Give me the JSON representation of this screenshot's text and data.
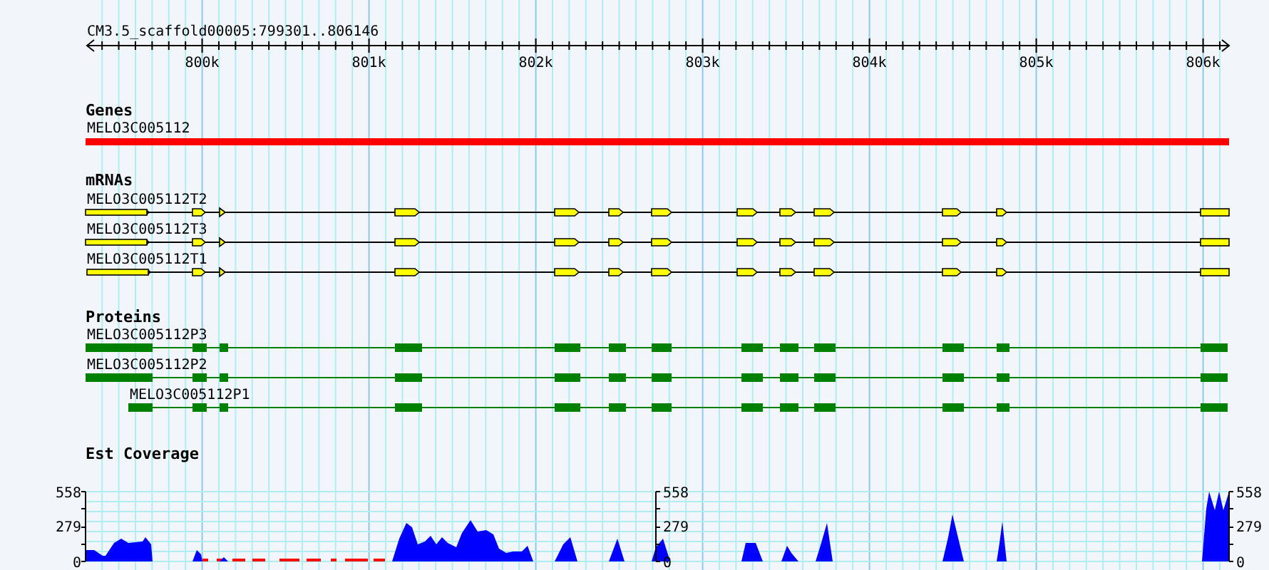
{
  "ruler": {
    "title": "CM3.5_scaffold00005:799301..806146",
    "ticks": [
      "800k",
      "801k",
      "802k",
      "803k",
      "804k",
      "805k",
      "806k"
    ]
  },
  "tracks": [
    {
      "kind": "gene",
      "title": "Genes",
      "features": [
        {
          "name": "MELO3C005112"
        }
      ]
    },
    {
      "kind": "mrna",
      "title": "mRNAs",
      "features": [
        {
          "name": "MELO3C005112T2"
        },
        {
          "name": "MELO3C005112T3"
        },
        {
          "name": "MELO3C005112T1"
        }
      ]
    },
    {
      "kind": "protein",
      "title": "Proteins",
      "features": [
        {
          "name": "MELO3C005112P3"
        },
        {
          "name": "MELO3C005112P2"
        },
        {
          "name": "MELO3C005112P1"
        }
      ]
    },
    {
      "kind": "coverage",
      "title": "Est Coverage",
      "axes": [
        {
          "labels": [
            "558",
            "279",
            "0"
          ]
        },
        {
          "labels": [
            "558",
            "279",
            "0"
          ]
        },
        {
          "labels": [
            "558",
            "279",
            "0"
          ]
        }
      ]
    }
  ]
}
